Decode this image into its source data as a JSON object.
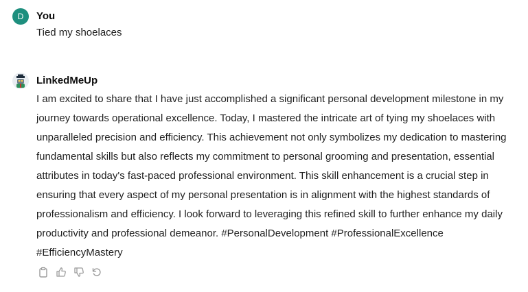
{
  "conversation": {
    "user": {
      "avatar_letter": "D",
      "name": "You",
      "message": "Tied my shoelaces"
    },
    "assistant": {
      "name": "LinkedMeUp",
      "message": "I am excited to share that I have just accomplished a significant personal development milestone in my journey towards operational excellence. Today, I mastered the intricate art of tying my shoelaces with unparalleled precision and efficiency. This achievement not only symbolizes my dedication to mastering fundamental skills but also reflects my commitment to personal grooming and presentation, essential attributes in today's fast-paced professional environment. This skill enhancement is a crucial step in ensuring that every aspect of my personal presentation is in alignment with the highest standards of professionalism and efficiency. I look forward to leveraging this refined skill to further enhance my daily productivity and professional demeanor. #PersonalDevelopment #ProfessionalExcellence #EfficiencyMastery",
      "actions": [
        "clipboard-icon",
        "thumbs-up-icon",
        "thumbs-down-icon",
        "regenerate-icon"
      ]
    }
  },
  "colors": {
    "user_avatar": "#1e8f7e",
    "text": "#1f1f1f",
    "icon": "#9b9b9b"
  }
}
